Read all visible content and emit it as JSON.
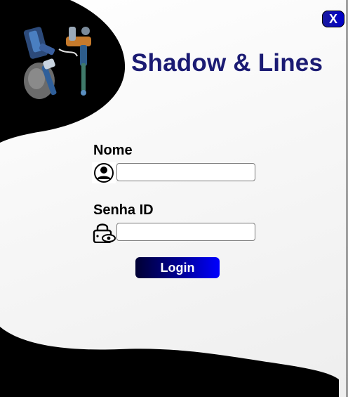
{
  "window": {
    "title": "Shadow & Lines",
    "close_label": "X"
  },
  "form": {
    "name_label": "Nome",
    "name_value": "",
    "name_placeholder": "",
    "password_label": "Senha ID",
    "password_value": "",
    "password_placeholder": "",
    "login_label": "Login"
  },
  "icons": {
    "logo": "tattoo-machine-logo",
    "name": "user-icon",
    "password": "lock-eye-icon",
    "close": "close-icon"
  },
  "colors": {
    "title": "#1b1b73",
    "accent": "#0000ff",
    "button_dark": "#000033",
    "background_shape": "#000000"
  }
}
